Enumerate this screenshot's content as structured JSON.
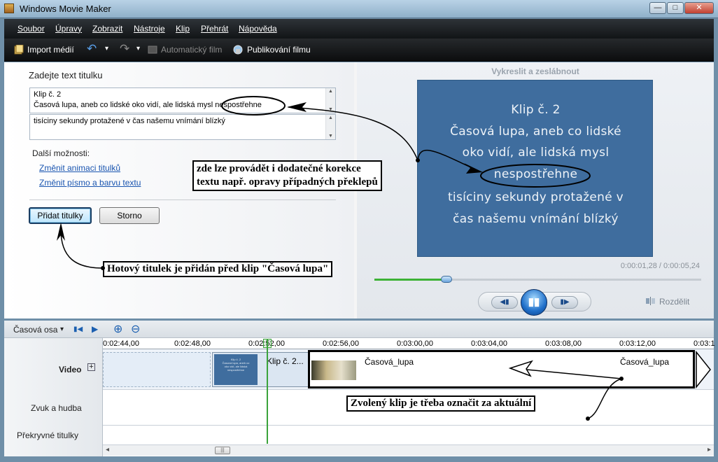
{
  "window": {
    "title": "Windows Movie Maker",
    "minimize_glyph": "—",
    "maximize_glyph": "□",
    "close_glyph": "✕"
  },
  "menu": [
    "Soubor",
    "Úpravy",
    "Zobrazit",
    "Nástroje",
    "Klip",
    "Přehrát",
    "Nápověda"
  ],
  "toolbar": {
    "import": "Import médií",
    "auto_movie": "Automatický film",
    "publish": "Publikování filmu",
    "undo_glyph": "↶",
    "redo_glyph": "↷",
    "dropdown_glyph": "▾"
  },
  "title_editor": {
    "heading": "Zadejte text titulku",
    "text_lines": [
      "Klip č. 2",
      "Časová lupa, aneb co lidské oko vidí, ale lidská mysl nespostřehne"
    ],
    "text_lines2": [
      "tisíciny sekundy protažené v čas našemu vnímání blízký"
    ],
    "more_options": "Další možnosti:",
    "link_animation": "Změnit animaci titulků",
    "link_font": "Změnit písmo a barvu textu",
    "add_button": "Přidat titulky",
    "cancel_button": "Storno"
  },
  "preview": {
    "effect_name": "Vykreslit a zeslábnout",
    "screen_lines": [
      "Klip č. 2",
      "Časová lupa, aneb co lidské",
      "oko vidí, ale lidská mysl",
      "nespostřehne",
      "tisíciny sekundy protažené v",
      "čas našemu vnímání blízký"
    ],
    "timecode": "0:00:01,28 / 0:00:05,24",
    "progress": 0.22,
    "split_label": "Rozdělit",
    "prev_glyph": "◀▮",
    "play_glyph": "▮▮",
    "next_glyph": "▮▶"
  },
  "timeline": {
    "view_label": "Časová osa",
    "dropdown_glyph": "▾",
    "first_glyph": "▮◀",
    "play_glyph": "▶",
    "zoom_in_glyph": "⊕",
    "zoom_out_glyph": "⊖",
    "ticks": [
      "0:02:44,00",
      "0:02:48,00",
      "0:02:52,00",
      "0:02:56,00",
      "0:03:00,00",
      "0:03:04,00",
      "0:03:08,00",
      "0:03:12,00",
      "0:03:1"
    ],
    "tracks": {
      "video": "Video",
      "expand": "+",
      "audio": "Zvuk a hudba",
      "overlay": "Překryvné titulky"
    },
    "clips": {
      "title_clip": "Klip č. 2...",
      "lupa_a": "Časová_lupa",
      "lupa_b": "Časová_lupa",
      "thumb_lines": [
        "Klip č. 2",
        "Časová lupa, aneb co",
        "oko vidí, ale lidská",
        "nespostřehne"
      ]
    },
    "scroll_left": "◂",
    "scroll_right": "▸",
    "scroll_grip": "|||"
  },
  "annotations": {
    "correction_1": "zde lze provádět i dodatečné korekce",
    "correction_2": "textu např. opravy případných překlepů",
    "added": "Hotový titulek je přidán před klip \"Časová lupa\"",
    "selected": "Zvolený klip je třeba označit za aktuální"
  }
}
